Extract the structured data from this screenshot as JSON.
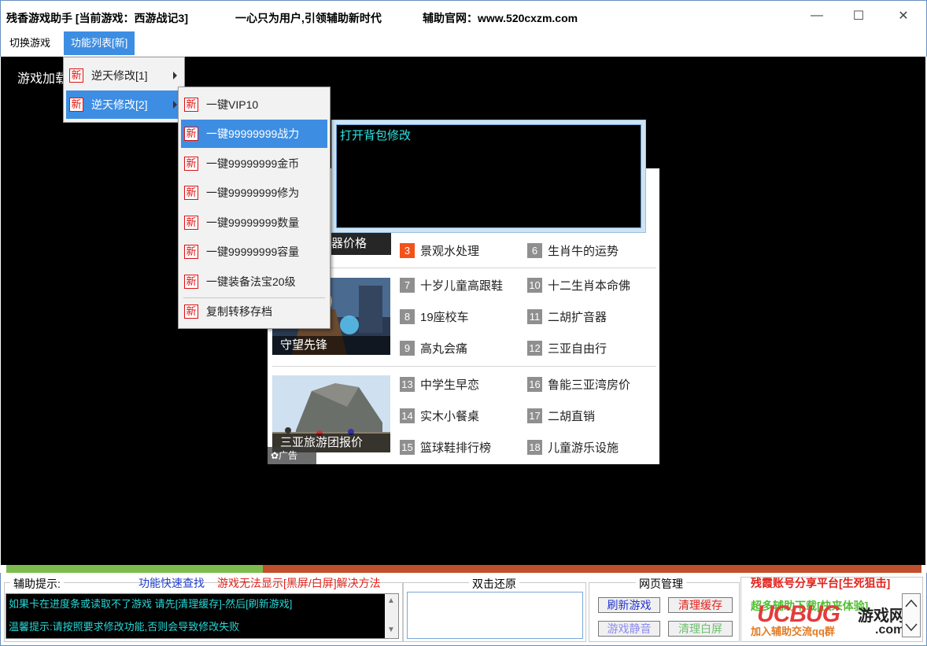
{
  "titlebar": {
    "app_title": "残香游戏助手 [当前游戏：西游战记3]",
    "slogan": "一心只为用户,引领辅助新时代",
    "website": "辅助官网：www.520cxzm.com",
    "minimize": "—",
    "maximize": "☐",
    "close": "✕"
  },
  "menubar": {
    "switch_game": "切换游戏",
    "feature_list": "功能列表[新]"
  },
  "game": {
    "loading_text": "游戏加载"
  },
  "menu_badge": "新",
  "menu1": {
    "items": [
      {
        "label": "逆天修改[1]"
      },
      {
        "label": "逆天修改[2]"
      }
    ]
  },
  "menu2": {
    "items": [
      {
        "label": "一键VIP10"
      },
      {
        "label": "一键99999999战力"
      },
      {
        "label": "一键99999999金币"
      },
      {
        "label": "一键99999999修为"
      },
      {
        "label": "一键99999999数量"
      },
      {
        "label": "一键99999999容量"
      },
      {
        "label": "一键装备法宝20级"
      },
      {
        "label": "复制转移存档"
      }
    ]
  },
  "bag_popup": {
    "label": "打开背包修改"
  },
  "ad": {
    "partial_caption": "器价格",
    "thumb1_caption": "守望先锋",
    "thumb2_caption": "三亚旅游团报价",
    "ad_tag": "✿广告",
    "items": [
      {
        "num": "3",
        "text": "景观水处理"
      },
      {
        "num": "6",
        "text": "生肖牛的运势"
      },
      {
        "num": "7",
        "text": "十岁儿童高跟鞋"
      },
      {
        "num": "10",
        "text": "十二生肖本命佛"
      },
      {
        "num": "8",
        "text": "19座校车"
      },
      {
        "num": "11",
        "text": "二胡扩音器"
      },
      {
        "num": "9",
        "text": "高丸会痛"
      },
      {
        "num": "12",
        "text": "三亚自由行"
      },
      {
        "num": "13",
        "text": "中学生早恋"
      },
      {
        "num": "16",
        "text": "鲁能三亚湾房价"
      },
      {
        "num": "14",
        "text": "实木小餐桌"
      },
      {
        "num": "17",
        "text": "二胡直销"
      },
      {
        "num": "15",
        "text": "篮球鞋排行榜"
      },
      {
        "num": "18",
        "text": "儿童游乐设施"
      }
    ]
  },
  "progress": {
    "fraction": 0.28
  },
  "bottom": {
    "tips_title": "辅助提示:",
    "quick_search": "功能快速查找",
    "black_screen_fix": "游戏无法显示[黑屏/白屏]解决方法",
    "tip_line1": "如果卡在进度条或读取不了游戏 请先[清理缓存]-然后[刷新游戏]",
    "tip_line2": "温馨提示:请按照要求修改功能,否则会导致修改失败",
    "restore_title": "双击还原",
    "web_title": "网页管理",
    "refresh_game": "刷新游戏",
    "clear_cache": "清理缓存",
    "mute_game": "游戏静音",
    "clear_white": "清理白屏",
    "account_platform": "残霞账号分享平台[生死狙击]",
    "download_text": "超多辅助下载[快来体验]",
    "join_group": "加入辅助交流qq群"
  },
  "watermark": {
    "logo": "UCBUG",
    "site_cn": "游戏网",
    "site_dom": ".com"
  },
  "colors": {
    "menu_highlight": "#3d8ee3",
    "badge_red": "#dd1111",
    "tip_text": "#27d7d7",
    "progress_done": "#7dbb4e",
    "progress_rest": "#c0502d"
  }
}
